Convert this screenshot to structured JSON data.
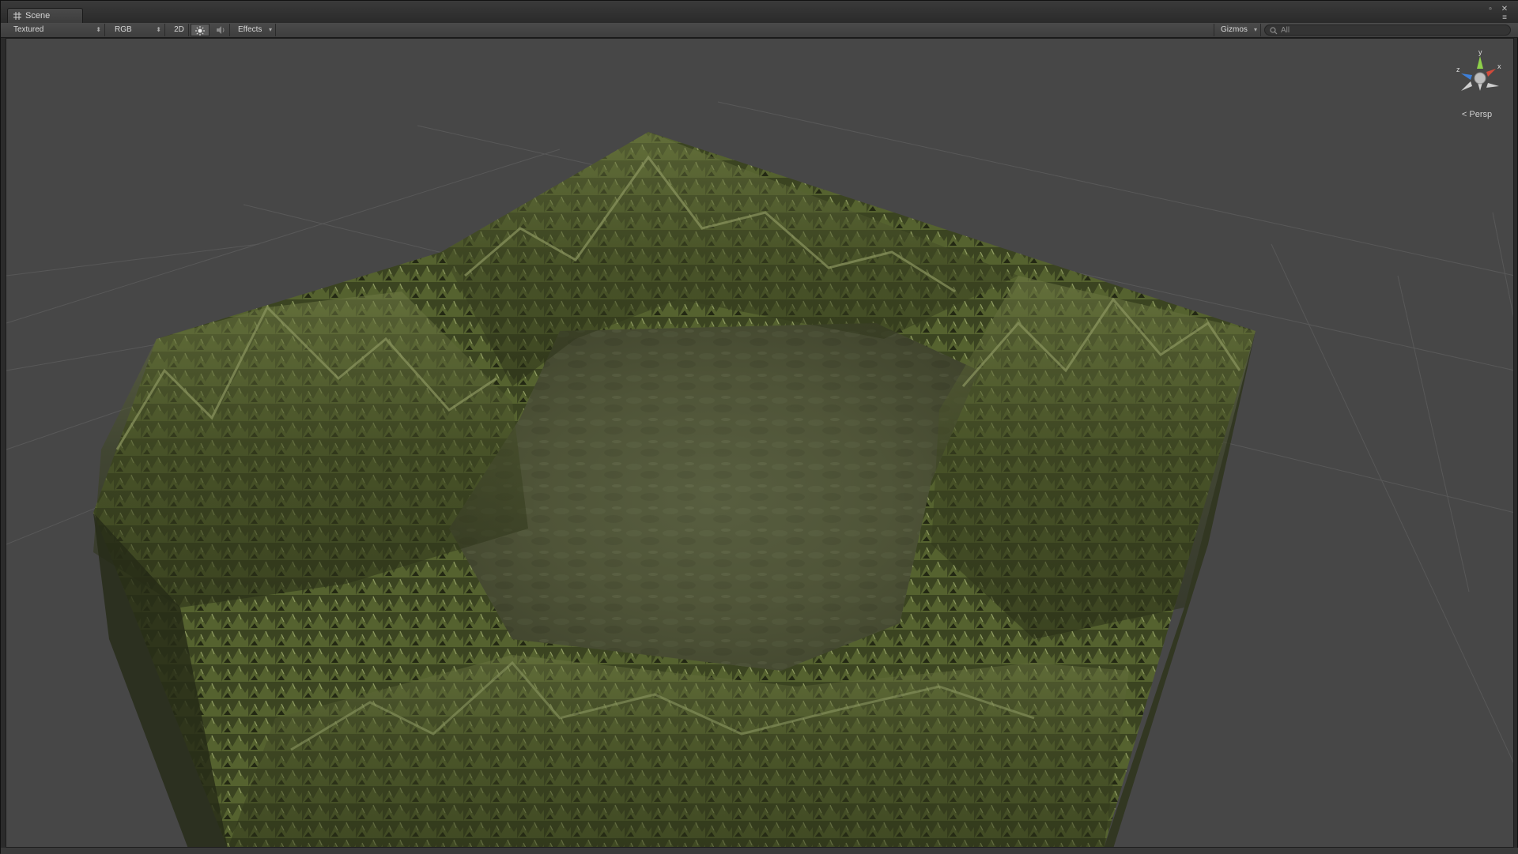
{
  "window": {
    "tab_label": "Scene"
  },
  "toolbar": {
    "draw_mode": "Textured",
    "render_mode": "RGB",
    "toggle_2d": "2D",
    "effects_label": "Effects",
    "gizmos_label": "Gizmos",
    "search_placeholder": "All"
  },
  "viewport": {
    "projection_label": "Persp",
    "gizmo_axes": {
      "y": "y",
      "x": "x",
      "z": "z"
    }
  },
  "colors": {
    "viewport_bg": "#474747",
    "grid_line": "#5a5a5a",
    "terrain_dark": "#2a3018",
    "terrain_mid": "#4b5a2c",
    "terrain_light": "#7c8a52",
    "water": "#555a3e",
    "axis_x": "#d24a3a",
    "axis_y": "#8ed04a",
    "axis_z": "#3d7fd8"
  },
  "icons": {
    "tab_icon": "scene-grid-icon",
    "lighting_toggle": "sun-icon",
    "audio_toggle": "speaker-icon",
    "search": "search-icon",
    "maximize": "maximize-icon",
    "close": "close-icon",
    "panel_menu": "panel-menu-icon"
  }
}
